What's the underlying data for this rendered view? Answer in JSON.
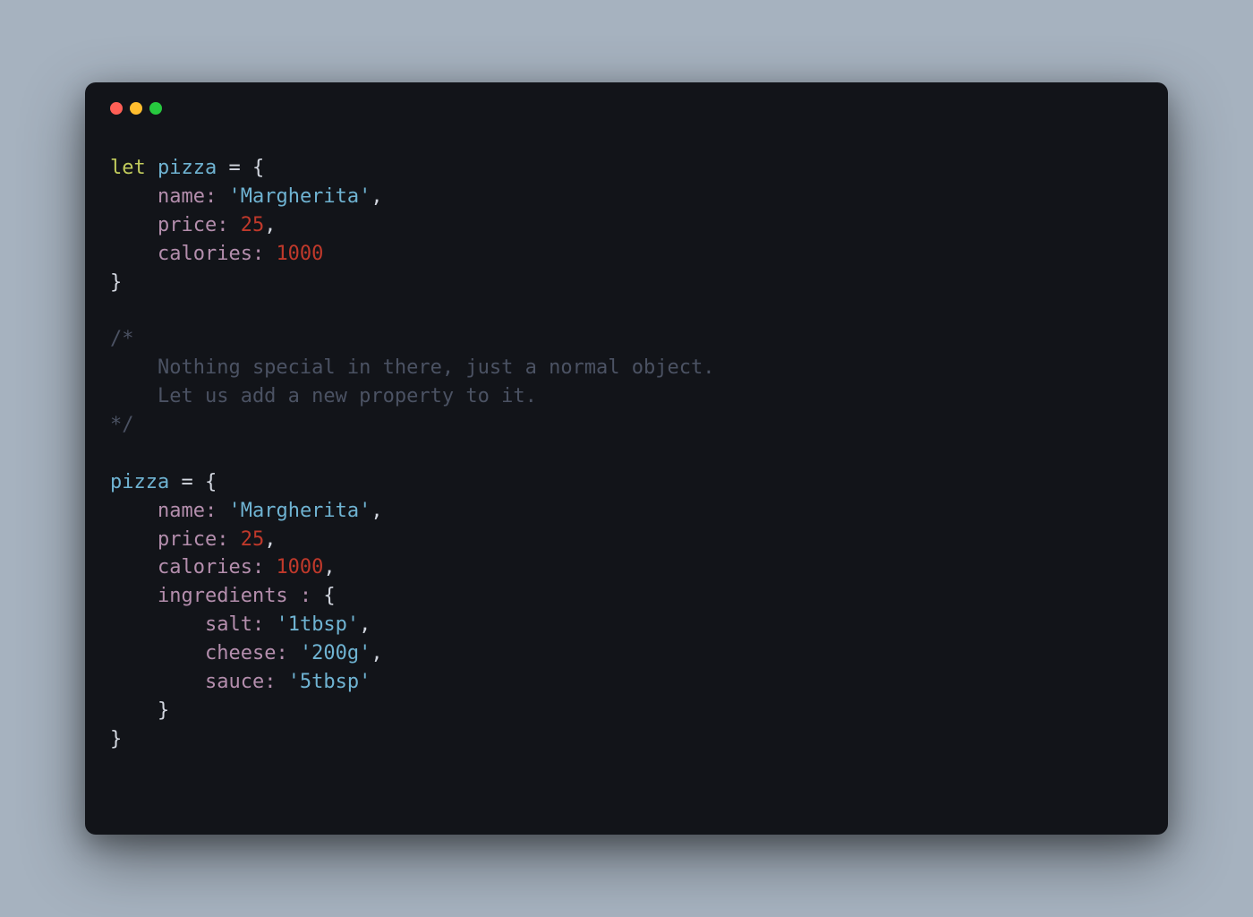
{
  "code": {
    "kw_let": "let",
    "var_pizza": "pizza",
    "eq": " = ",
    "lbrace": "{",
    "rbrace": "}",
    "comma": ",",
    "props": {
      "name": "name: ",
      "price": "price: ",
      "calories": "calories: ",
      "ingredients": "ingredients : ",
      "salt": "salt: ",
      "cheese": "cheese: ",
      "sauce": "sauce: "
    },
    "vals": {
      "margherita": "'Margherita'",
      "price25": "25",
      "cal1000": "1000",
      "tbsp1": "'1tbsp'",
      "g200": "'200g'",
      "tbsp5": "'5tbsp'"
    },
    "comment": {
      "open": "/*",
      "line1": "    Nothing special in there, just a normal object.",
      "line2": "    Let us add a new property to it.",
      "close": "*/"
    }
  }
}
